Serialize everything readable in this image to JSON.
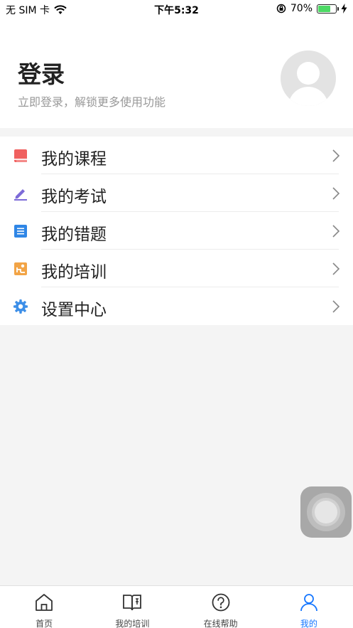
{
  "status_bar": {
    "carrier": "无 SIM 卡",
    "time": "下午5:32",
    "battery_percent": "70%",
    "battery_level": 0.7
  },
  "profile": {
    "title": "登录",
    "subtitle": "立即登录，解锁更多使用功能"
  },
  "menu": {
    "items": [
      {
        "label": "我的课程",
        "icon": "book-icon",
        "color": "#f0605f"
      },
      {
        "label": "我的考试",
        "icon": "pencil-icon",
        "color": "#7d6bd8"
      },
      {
        "label": "我的错题",
        "icon": "list-icon",
        "color": "#2f86e6"
      },
      {
        "label": "我的培训",
        "icon": "training-icon",
        "color": "#f2a446"
      },
      {
        "label": "设置中心",
        "icon": "gear-icon",
        "color": "#3d8fe8"
      }
    ]
  },
  "tabbar": {
    "tabs": [
      {
        "label": "首页",
        "icon": "home-icon",
        "active": false
      },
      {
        "label": "我的培训",
        "icon": "open-book-icon",
        "active": false
      },
      {
        "label": "在线帮助",
        "icon": "question-icon",
        "active": false
      },
      {
        "label": "我的",
        "icon": "person-icon",
        "active": true
      }
    ],
    "active_color": "#1677ff"
  }
}
